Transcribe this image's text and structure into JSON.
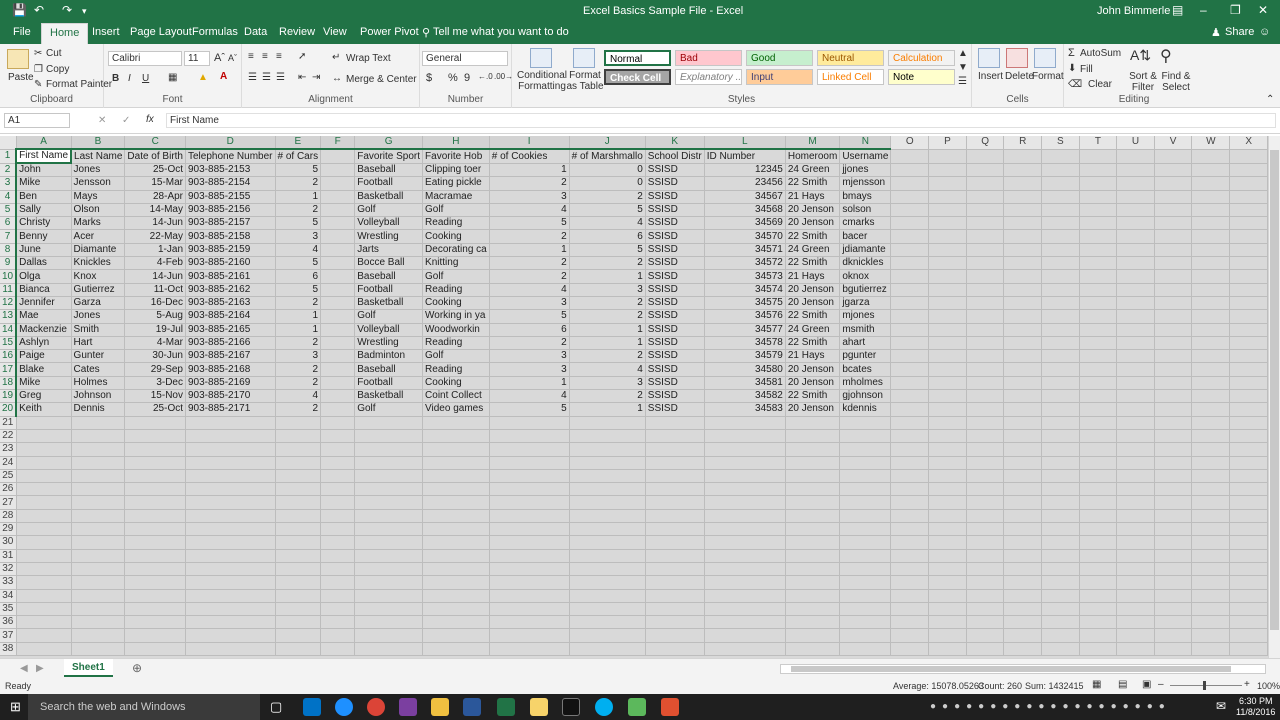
{
  "window": {
    "title": "Excel Basics Sample File  -  Excel",
    "user": "John Bimmerle"
  },
  "ribbon_tabs": [
    "File",
    "Home",
    "Insert",
    "Page Layout",
    "Formulas",
    "Data",
    "Review",
    "View",
    "Power Pivot"
  ],
  "tell_me": "Tell me what you want to do",
  "share": "Share",
  "clipboard": {
    "paste": "Paste",
    "cut": "Cut",
    "copy": "Copy",
    "format_painter": "Format Painter",
    "label": "Clipboard"
  },
  "font": {
    "name": "Calibri",
    "size": "11",
    "bold": "B",
    "italic": "I",
    "underline": "U",
    "label": "Font"
  },
  "alignment": {
    "wrap": "Wrap Text",
    "merge": "Merge & Center",
    "label": "Alignment"
  },
  "number": {
    "format": "General",
    "currency": "$",
    "percent": "%",
    "comma": "9",
    "label": "Number"
  },
  "styles": {
    "conditional": "Conditional Formatting",
    "format_table": "Format as Table",
    "cells": [
      {
        "text": "Normal",
        "bg": "#ffffff",
        "fg": "#000000"
      },
      {
        "text": "Bad",
        "bg": "#ffc7ce",
        "fg": "#9c0006"
      },
      {
        "text": "Good",
        "bg": "#c6efce",
        "fg": "#006100"
      },
      {
        "text": "Neutral",
        "bg": "#ffeb9c",
        "fg": "#9c5700"
      },
      {
        "text": "Calculation",
        "bg": "#f2f2f2",
        "fg": "#fa7d00"
      },
      {
        "text": "Check Cell",
        "bg": "#a5a5a5",
        "fg": "#ffffff"
      },
      {
        "text": "Explanatory ...",
        "bg": "#ffffff",
        "fg": "#7f7f7f"
      },
      {
        "text": "Input",
        "bg": "#ffcc99",
        "fg": "#3f3f76"
      },
      {
        "text": "Linked Cell",
        "bg": "#ffffff",
        "fg": "#fa7d00"
      },
      {
        "text": "Note",
        "bg": "#ffffcc",
        "fg": "#000000"
      }
    ],
    "label": "Styles"
  },
  "cells_group": {
    "insert": "Insert",
    "delete": "Delete",
    "format": "Format",
    "label": "Cells"
  },
  "editing": {
    "autosum": "AutoSum",
    "fill": "Fill",
    "clear": "Clear",
    "sort": "Sort & Filter",
    "find": "Find & Select",
    "label": "Editing"
  },
  "formula_bar": {
    "name_box": "A1",
    "fx": "fx",
    "content": "First Name"
  },
  "columns": [
    "A",
    "B",
    "C",
    "D",
    "E",
    "F",
    "G",
    "H",
    "I",
    "J",
    "K",
    "L",
    "M",
    "N",
    "O",
    "P",
    "Q",
    "R",
    "S",
    "T",
    "U",
    "V",
    "W",
    "X"
  ],
  "header_row": [
    "First Name",
    "Last Name",
    "Date of Birth",
    "Telephone Number",
    "# of Cars",
    "",
    "Favorite Sport",
    "Favorite Hob",
    "# of Cookies",
    "# of Marshmallo",
    "School Distr",
    "ID Number",
    "Homeroom",
    "Username"
  ],
  "rows": [
    [
      "John",
      "Jones",
      "25-Oct",
      "903-885-2153",
      "5",
      "",
      "Baseball",
      "Clipping toer",
      "1",
      "0",
      "SSISD",
      "12345",
      "24 Green",
      "jjones"
    ],
    [
      "Mike",
      "Jensson",
      "15-Mar",
      "903-885-2154",
      "2",
      "",
      "Football",
      "Eating pickle",
      "2",
      "0",
      "SSISD",
      "23456",
      "22 Smith",
      "mjensson"
    ],
    [
      "Ben",
      "Mays",
      "28-Apr",
      "903-885-2155",
      "1",
      "",
      "Basketball",
      "Macramae",
      "3",
      "2",
      "SSISD",
      "34567",
      "21 Hays",
      "bmays"
    ],
    [
      "Sally",
      "Olson",
      "14-May",
      "903-885-2156",
      "2",
      "",
      "Golf",
      "Golf",
      "4",
      "5",
      "SSISD",
      "34568",
      "20 Jenson",
      "solson"
    ],
    [
      "Christy",
      "Marks",
      "14-Jun",
      "903-885-2157",
      "5",
      "",
      "Volleyball",
      "Reading",
      "5",
      "4",
      "SSISD",
      "34569",
      "20 Jenson",
      "cmarks"
    ],
    [
      "Benny",
      "Acer",
      "22-May",
      "903-885-2158",
      "3",
      "",
      "Wrestling",
      "Cooking",
      "2",
      "6",
      "SSISD",
      "34570",
      "22 Smith",
      "bacer"
    ],
    [
      "June",
      "Diamante",
      "1-Jan",
      "903-885-2159",
      "4",
      "",
      "Jarts",
      "Decorating ca",
      "1",
      "5",
      "SSISD",
      "34571",
      "24 Green",
      "jdiamante"
    ],
    [
      "Dallas",
      "Knickles",
      "4-Feb",
      "903-885-2160",
      "5",
      "",
      "Bocce Ball",
      "Knitting",
      "2",
      "2",
      "SSISD",
      "34572",
      "22 Smith",
      "dknickles"
    ],
    [
      "Olga",
      "Knox",
      "14-Jun",
      "903-885-2161",
      "6",
      "",
      "Baseball",
      "Golf",
      "2",
      "1",
      "SSISD",
      "34573",
      "21 Hays",
      "oknox"
    ],
    [
      "Bianca",
      "Gutierrez",
      "11-Oct",
      "903-885-2162",
      "5",
      "",
      "Football",
      "Reading",
      "4",
      "3",
      "SSISD",
      "34574",
      "20 Jenson",
      "bgutierrez"
    ],
    [
      "Jennifer",
      "Garza",
      "16-Dec",
      "903-885-2163",
      "2",
      "",
      "Basketball",
      "Cooking",
      "3",
      "2",
      "SSISD",
      "34575",
      "20 Jenson",
      "jgarza"
    ],
    [
      "Mae",
      "Jones",
      "5-Aug",
      "903-885-2164",
      "1",
      "",
      "Golf",
      "Working in ya",
      "5",
      "2",
      "SSISD",
      "34576",
      "22 Smith",
      "mjones"
    ],
    [
      "Mackenzie",
      "Smith",
      "19-Jul",
      "903-885-2165",
      "1",
      "",
      "Volleyball",
      "Woodworkin",
      "6",
      "1",
      "SSISD",
      "34577",
      "24 Green",
      "msmith"
    ],
    [
      "Ashlyn",
      "Hart",
      "4-Mar",
      "903-885-2166",
      "2",
      "",
      "Wrestling",
      "Reading",
      "2",
      "1",
      "SSISD",
      "34578",
      "22 Smith",
      "ahart"
    ],
    [
      "Paige",
      "Gunter",
      "30-Jun",
      "903-885-2167",
      "3",
      "",
      "Badminton",
      "Golf",
      "3",
      "2",
      "SSISD",
      "34579",
      "21 Hays",
      "pgunter"
    ],
    [
      "Blake",
      "Cates",
      "29-Sep",
      "903-885-2168",
      "2",
      "",
      "Baseball",
      "Reading",
      "3",
      "4",
      "SSISD",
      "34580",
      "20 Jenson",
      "bcates"
    ],
    [
      "Mike",
      "Holmes",
      "3-Dec",
      "903-885-2169",
      "2",
      "",
      "Football",
      "Cooking",
      "1",
      "3",
      "SSISD",
      "34581",
      "20 Jenson",
      "mholmes"
    ],
    [
      "Greg",
      "Johnson",
      "15-Nov",
      "903-885-2170",
      "4",
      "",
      "Basketball",
      "Coint Collect",
      "4",
      "2",
      "SSISD",
      "34582",
      "22 Smith",
      "gjohnson"
    ],
    [
      "Keith",
      "Dennis",
      "25-Oct",
      "903-885-2171",
      "2",
      "",
      "Golf",
      "Video games",
      "5",
      "1",
      "SSISD",
      "34583",
      "20 Jenson",
      "kdennis"
    ]
  ],
  "total_rows": 38,
  "sheet_tab": "Sheet1",
  "status": {
    "ready": "Ready",
    "average": "Average: 15078.05263",
    "count": "Count: 260",
    "sum": "Sum: 1432415",
    "zoom": "100%"
  },
  "taskbar": {
    "search": "Search the web and Windows",
    "time": "6:30 PM",
    "date": "11/8/2016"
  }
}
